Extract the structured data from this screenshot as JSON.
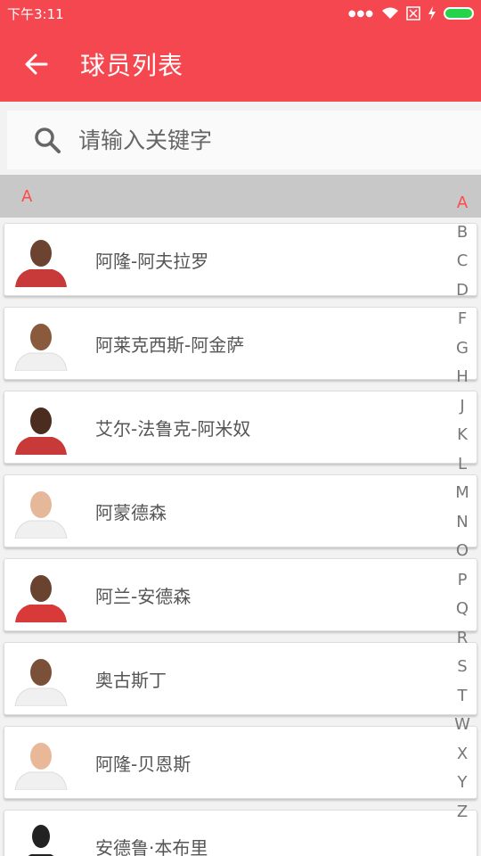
{
  "status_bar": {
    "time": "下午3:11"
  },
  "app_bar": {
    "title": "球员列表"
  },
  "search": {
    "placeholder": "请输入关键字"
  },
  "section": {
    "letter": "A"
  },
  "players": [
    {
      "name": "阿隆-阿夫拉罗",
      "jersey": "#c83a3a"
    },
    {
      "name": "阿莱克西斯-阿金萨",
      "jersey": "#f0f0f0"
    },
    {
      "name": "艾尔-法鲁克-阿米奴",
      "jersey": "#c83a3a"
    },
    {
      "name": "阿蒙德森",
      "jersey": "#f0f0f0"
    },
    {
      "name": "阿兰-安德森",
      "jersey": "#d83a3a"
    },
    {
      "name": "奥古斯丁",
      "jersey": "#f0f0f0"
    },
    {
      "name": "阿隆-贝恩斯",
      "jersey": "#f0f0f0"
    },
    {
      "name": "安德鲁·本布里",
      "jersey": "#222222"
    }
  ],
  "alphabet": [
    "A",
    "B",
    "C",
    "D",
    "F",
    "G",
    "H",
    "J",
    "K",
    "L",
    "M",
    "N",
    "O",
    "P",
    "Q",
    "R",
    "S",
    "T",
    "W",
    "X",
    "Y",
    "Z"
  ],
  "alphabet_active": "A",
  "colors": {
    "accent": "#f5474f",
    "index_active": "#ff4a4a"
  }
}
